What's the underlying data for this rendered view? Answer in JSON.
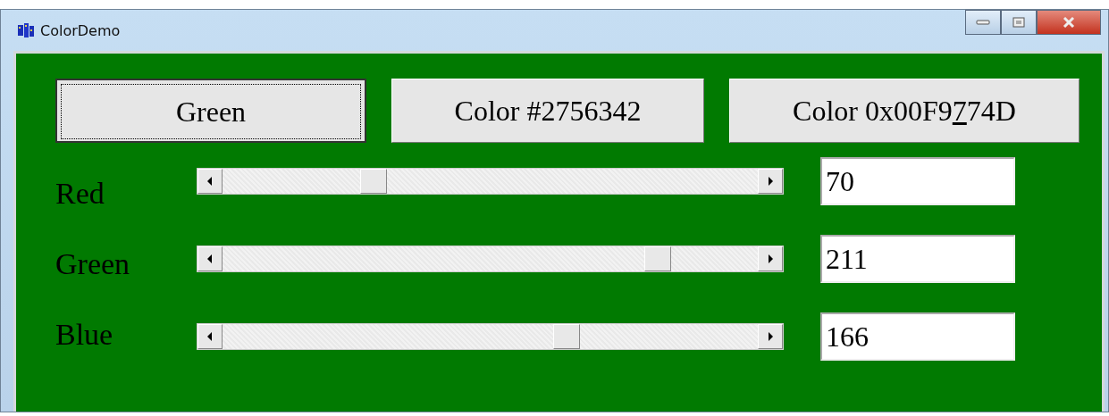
{
  "window": {
    "title": "ColorDemo"
  },
  "buttons": [
    {
      "text_before": "Green",
      "selected": true
    },
    {
      "text_before": "Color #2756342",
      "selected": false
    },
    {
      "text_before": "Color 0x00F9",
      "mnemonic": "7",
      "text_after": "74D",
      "selected": false
    }
  ],
  "channels": [
    {
      "name": "Red",
      "value": "70"
    },
    {
      "name": "Green",
      "value": "211"
    },
    {
      "name": "Blue",
      "value": "166"
    }
  ]
}
